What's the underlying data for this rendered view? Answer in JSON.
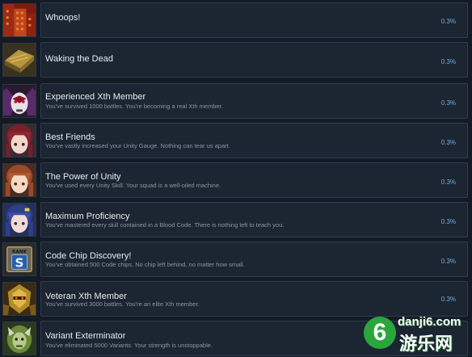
{
  "achievements": [
    {
      "title": "Whoops!",
      "description": "",
      "percent": "0.3%",
      "icon": "red-building-icon"
    },
    {
      "title": "Waking the Dead",
      "description": "",
      "percent": "0.3%",
      "icon": "gold-coffin-icon"
    },
    {
      "title": "Experienced Xth Member",
      "description": "You've survived 1000 battles. You're becoming a real Xth member.",
      "percent": "0.3%",
      "icon": "masked-warrior-portrait-icon"
    },
    {
      "title": "Best Friends",
      "description": "You've vastly increased your Unity Gauge. Nothing can tear us apart.",
      "percent": "0.3%",
      "icon": "red-haired-girl-portrait-icon"
    },
    {
      "title": "The Power of Unity",
      "description": "You've used every Unity Skill. Your squad is a well-oiled machine.",
      "percent": "0.3%",
      "icon": "brown-haired-girl-portrait-icon"
    },
    {
      "title": "Maximum Proficiency",
      "description": "You've mastered every skill contained in a Blood Code. There is nothing left to teach you.",
      "percent": "0.3%",
      "icon": "blue-haired-girl-portrait-icon"
    },
    {
      "title": "Code Chip Discovery!",
      "description": "You've obtained 500 Code chips. No chip left behind, no matter how small.",
      "percent": "0.3%",
      "icon": "rank-s-badge-icon"
    },
    {
      "title": "Veteran Xth Member",
      "description": "You've survived 3000 battles. You're an elite Xth member.",
      "percent": "0.3%",
      "icon": "gold-armored-warrior-icon"
    },
    {
      "title": "Variant Exterminator",
      "description": "You've eliminated 5000 Variants. Your strength is unstoppable.",
      "percent": "",
      "icon": "green-monster-icon"
    }
  ],
  "rank_badge": {
    "label": "RANK",
    "letter": "S"
  },
  "watermark": {
    "six": "6",
    "domain": "danji6.com",
    "chinese": "游乐网"
  }
}
